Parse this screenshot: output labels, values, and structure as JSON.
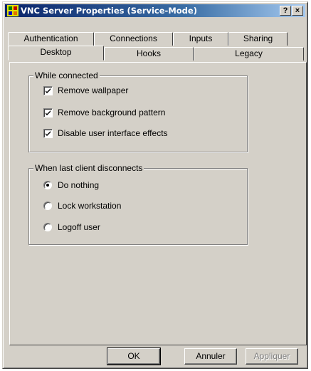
{
  "window": {
    "title": "VNC Server Properties (Service-Mode)",
    "help_glyph": "?",
    "close_glyph": "×"
  },
  "tabs": {
    "row_back": [
      "Authentication",
      "Connections",
      "Inputs",
      "Sharing"
    ],
    "row_front": [
      "Desktop",
      "Hooks",
      "Legacy"
    ],
    "selected": "Desktop"
  },
  "while_connected": {
    "legend": "While connected",
    "options": [
      {
        "label": "Remove wallpaper",
        "checked": true
      },
      {
        "label": "Remove background pattern",
        "checked": true
      },
      {
        "label": "Disable user interface effects",
        "checked": true
      }
    ]
  },
  "last_client": {
    "legend": "When last client disconnects",
    "options": [
      {
        "label": "Do nothing",
        "selected": true
      },
      {
        "label": "Lock workstation",
        "selected": false
      },
      {
        "label": "Logoff user",
        "selected": false
      }
    ]
  },
  "buttons": {
    "ok": "OK",
    "cancel": "Annuler",
    "apply": "Appliquer"
  },
  "colors": {
    "face": "#d4d0c8",
    "title_start": "#0a246a",
    "title_end": "#a6caf0"
  }
}
